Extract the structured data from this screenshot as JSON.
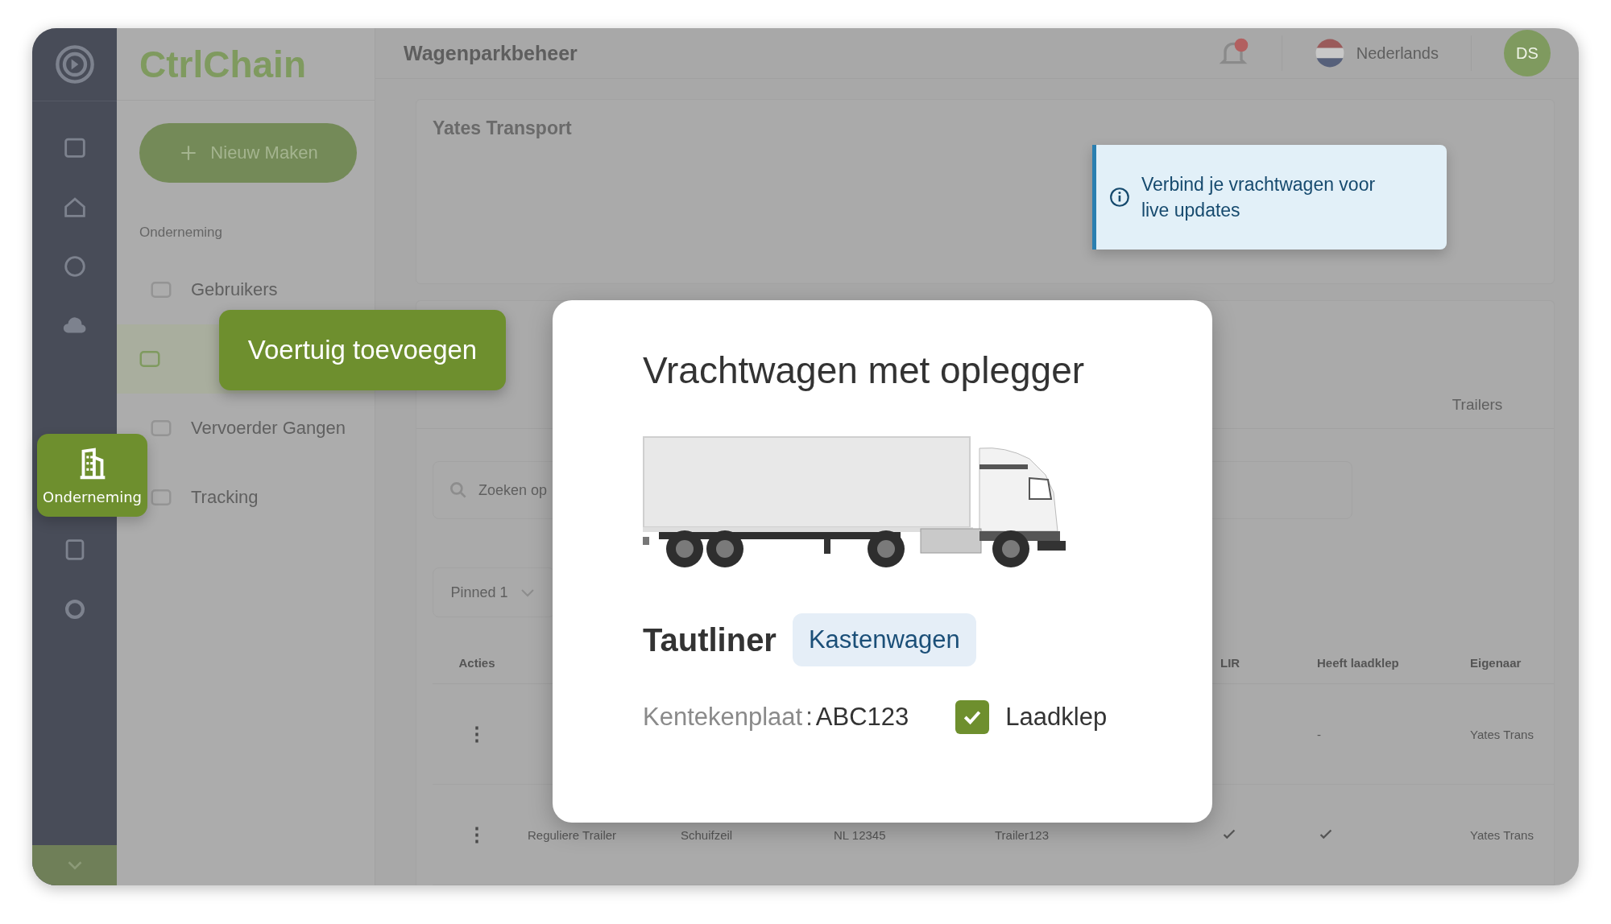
{
  "brand": "CtrlChain",
  "rail": {
    "active_label": "Onderneming"
  },
  "new_button": "Nieuw Maken",
  "nav": {
    "section": "Onderneming",
    "items": [
      {
        "label": "Gebruikers",
        "selected": false
      },
      {
        "selected": true
      },
      {
        "label": "Vervoerder Gangen",
        "selected": false
      },
      {
        "label": "Tracking",
        "selected": false
      }
    ]
  },
  "header": {
    "title": "Wagenparkbeheer",
    "language": "Nederlands",
    "avatar": "DS"
  },
  "company": {
    "name": "Yates Transport"
  },
  "tabs": [
    {
      "label": "Trailers",
      "selected": false
    }
  ],
  "search": {
    "placeholder": "Zoeken op"
  },
  "pinned_filter": "Pinned 1",
  "table": {
    "columns": {
      "actions": "Acties",
      "lir": "LIR",
      "tailgate": "Heeft laadklep",
      "owner": "Eigenaar"
    },
    "rows": [
      {
        "actions": "⋮",
        "tailgate": "-",
        "owner": "Yates Trans"
      },
      {
        "actions": "⋮",
        "column_2": "Reguliere Trailer",
        "column_3": "Schuifzeil",
        "column_4": "NL 12345",
        "column_5": "Trailer123",
        "lir": true,
        "tailgate": true,
        "owner": "Yates Trans"
      }
    ]
  },
  "tooltip": "Voertuig toevoegen",
  "toast": {
    "message": "Verbind je vrachtwagen voor live updates"
  },
  "modal": {
    "title": "Vrachtwagen met oplegger",
    "model": "Tautliner",
    "body_type": "Kastenwagen",
    "plate_label": "Kentekenplaat",
    "plate_separator": ":",
    "plate": "ABC123",
    "tailgate": {
      "label": "Laadklep",
      "checked": true
    }
  }
}
